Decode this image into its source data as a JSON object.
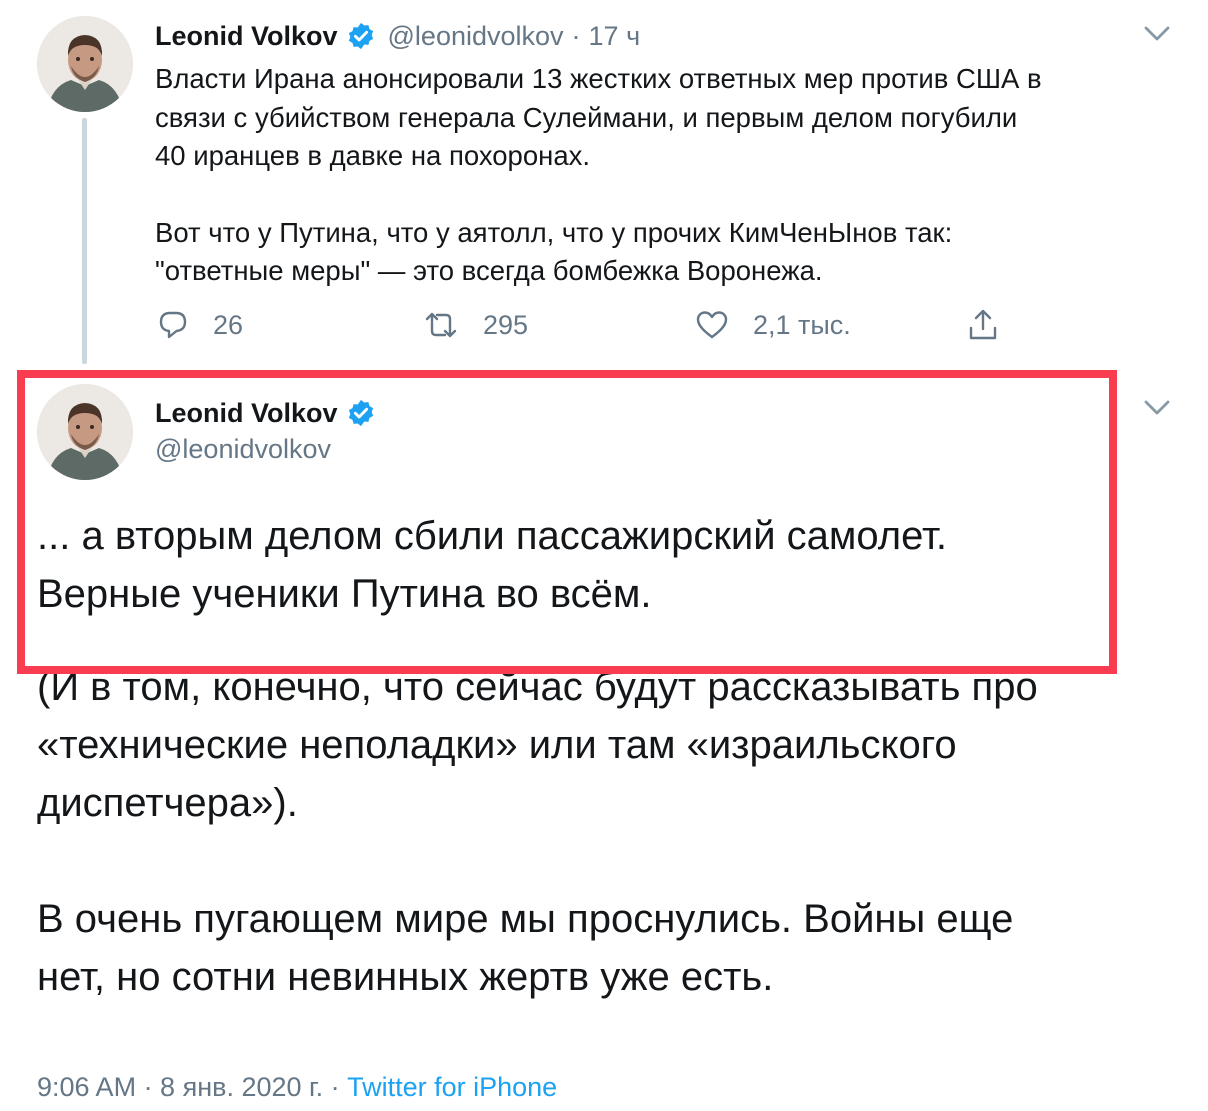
{
  "colors": {
    "text": "#14171a",
    "secondary": "#657786",
    "verified": "#1da1f2",
    "link": "#1da1f2",
    "highlight_border": "#fa3c50",
    "thread_line": "#ccd6dd"
  },
  "tweet1": {
    "author_name": "Leonid Volkov",
    "handle": "@leonidvolkov",
    "separator": "·",
    "time": "17 ч",
    "text_lines": [
      "Власти Ирана анонсировали 13 жестких ответных мер против США в",
      "связи с убийством генерала Сулеймани, и первым делом погубили",
      "40 иранцев в давке на похоронах.",
      "Вот что у Путина, что у аятолл, что у прочих КимЧенЫнов так:",
      "\"ответные меры\" — это всегда бомбежка Воронежа."
    ],
    "actions": {
      "reply_icon": "reply-icon",
      "reply_count": "26",
      "retweet_icon": "retweet-icon",
      "retweet_count": "295",
      "like_icon": "heart-icon",
      "like_count": "2,1 тыс.",
      "share_icon": "share-icon"
    },
    "menu_icon": "chevron-down-icon"
  },
  "tweet2": {
    "author_name": "Leonid Volkov",
    "handle": "@leonidvolkov",
    "verified_icon": "verified-badge-icon",
    "menu_icon": "chevron-down-icon",
    "text_lines": [
      "... а вторым делом сбили пассажирский самолет.",
      "Верные ученики Путина во всём.",
      "(И в том, конечно, что сейчас будут рассказывать про",
      "«технические неполадки» или там «израильского",
      "диспетчера»).",
      "В очень пугающем мире мы проснулись. Войны еще",
      "нет, но сотни невинных жертв уже есть."
    ],
    "timestamp": "9:06 AM · 8 янв. 2020 г. · ",
    "source": "Twitter for iPhone"
  }
}
